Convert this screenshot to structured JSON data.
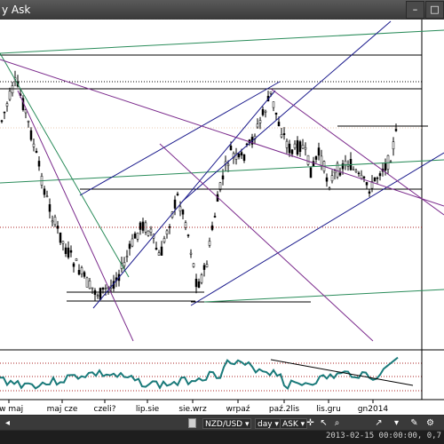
{
  "window": {
    "title": "y Ask"
  },
  "toolbar": {
    "symbol": "NZD/USD",
    "timeframe": "day",
    "price_side": "ASK"
  },
  "status": {
    "text": "2013-02-15 00:00:00, 0,7"
  },
  "axis": {
    "labels": [
      "kw maj",
      "maj cze",
      "czeli?",
      "lip.sie",
      "sie.wrz",
      "wrpaź",
      "paź.2lis",
      "lis.gru",
      "gn2014"
    ]
  },
  "colors": {
    "candle": "#000000",
    "trend_purple": "#7b2a8c",
    "trend_blue": "#1a1a8c",
    "trend_green": "#2a8c5a",
    "horizontal": "#000000",
    "oscillator": "#1a7a7a",
    "band_dotted": "#aa2222",
    "background": "#ffffff"
  }
}
